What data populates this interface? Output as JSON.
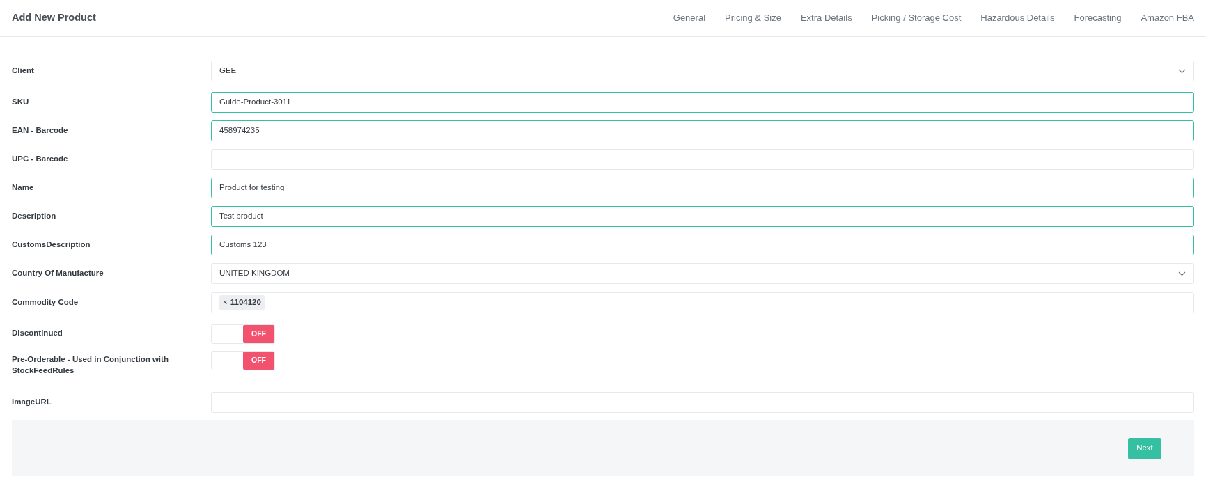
{
  "header": {
    "title": "Add New Product",
    "tabs": [
      {
        "label": "General",
        "selected": false
      },
      {
        "label": "Pricing & Size",
        "selected": false
      },
      {
        "label": "Extra Details",
        "selected": false
      },
      {
        "label": "Picking / Storage Cost",
        "selected": false
      },
      {
        "label": "Hazardous Details",
        "selected": false
      },
      {
        "label": "Forecasting",
        "selected": false
      },
      {
        "label": "Amazon FBA",
        "selected": false
      }
    ]
  },
  "fields": [
    {
      "kind": "select",
      "label": "Client",
      "value": "GEE"
    },
    {
      "kind": "text",
      "label": "SKU",
      "value": "Guide-Product-3011",
      "valid": true
    },
    {
      "kind": "text",
      "label": "EAN - Barcode",
      "value": "458974235",
      "valid": true
    },
    {
      "kind": "text",
      "label": "UPC - Barcode",
      "valid": false
    },
    {
      "kind": "text",
      "label": "Name",
      "value": "Product for testing",
      "valid": true
    },
    {
      "kind": "text",
      "label": "Description",
      "value": "Test product",
      "valid": true
    },
    {
      "kind": "text",
      "label": "CustomsDescription",
      "value": "Customs 123",
      "valid": true
    },
    {
      "kind": "select",
      "label": "Country Of Manufacture",
      "value": "UNITED KINGDOM"
    },
    {
      "kind": "tags",
      "label": "Commodity Code",
      "tags": [
        {
          "remove": "×",
          "text": "1104120"
        }
      ]
    },
    {
      "kind": "toggle",
      "label": "Discontinued",
      "on": false,
      "state_text": "OFF"
    },
    {
      "kind": "toggle",
      "label": "Pre-Orderable - Used in Conjunction with StockFeedRules",
      "on": false,
      "state_text": "OFF"
    },
    {
      "kind": "text",
      "label": "ImageURL",
      "valid": false
    }
  ],
  "footer": {
    "button": "Next"
  }
}
